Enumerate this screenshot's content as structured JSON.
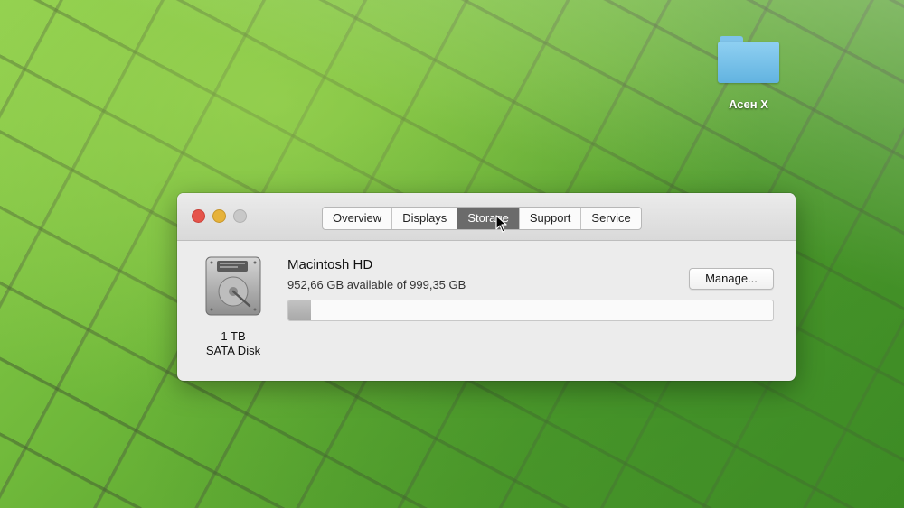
{
  "desktop": {
    "folder_label": "Асен Х"
  },
  "window": {
    "tabs": [
      {
        "label": "Overview",
        "active": false
      },
      {
        "label": "Displays",
        "active": false
      },
      {
        "label": "Storage",
        "active": true
      },
      {
        "label": "Support",
        "active": false
      },
      {
        "label": "Service",
        "active": false
      }
    ],
    "storage": {
      "disk_capacity": "1 TB",
      "disk_type": "SATA Disk",
      "disk_name": "Macintosh HD",
      "availability": "952,66 GB available of 999,35 GB",
      "manage_label": "Manage...",
      "used_fraction": 0.047,
      "icon": "hard-drive-icon"
    }
  },
  "colors": {
    "close": "#e5544b",
    "minimize": "#e6b23a",
    "zoom": "#c8c8c8",
    "active_tab": "#6b6b6b",
    "folder": "#62b3e0"
  }
}
